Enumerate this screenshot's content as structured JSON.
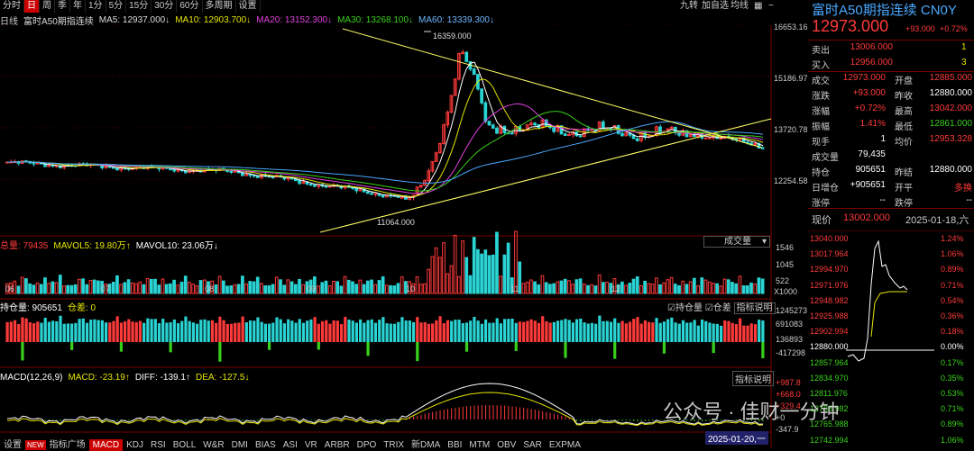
{
  "toolbar": {
    "items": [
      "分时",
      "日",
      "周",
      "季",
      "年",
      "1分",
      "5分",
      "15分",
      "30分",
      "60分",
      "多周期",
      "设置"
    ],
    "active": "日"
  },
  "top_right": {
    "btn1": "九转",
    "btn2": "加自选",
    "btn3": "均线"
  },
  "ma_header": {
    "period": "日线",
    "name": "富时A50期指连续",
    "ma5": "MA5: 12937.000↓",
    "ma10": "MA10: 12903.700↓",
    "ma20": "MA20: 13152.300↓",
    "ma30": "MA30: 13268.100↓",
    "ma60": "MA60: 13339.300↓"
  },
  "price_axis": {
    "t1": "16653.16",
    "t2": "15186.97",
    "t3": "13720.78",
    "t4": "12254.58"
  },
  "annot": {
    "high": "16359.000",
    "low": "11064.000"
  },
  "vol_header": {
    "label": "总量: 79435",
    "mavol5": "MAVOL5: 19.80万↑",
    "mavol10": "MAVOL10: 23.06万↓",
    "select": "成交量"
  },
  "vol_axis": {
    "t1": "1546",
    "t2": "1045",
    "t3": "522",
    "unit": "X1000"
  },
  "oi_header": {
    "label": "持仓量: 905651",
    "diff": "仓差: 0",
    "cb1": "持仓量",
    "cb2": "仓差",
    "explain": "指标说明"
  },
  "oi_axis": {
    "t1": "1245273",
    "t2": "691083",
    "t3": "136893",
    "t4": "-417298"
  },
  "macd_header": {
    "label": "MACD(12,26,9)",
    "macd": "MACD: -23.19↑",
    "diff": "DIFF: -139.1↑",
    "dea": "DEA: -127.5↓",
    "explain": "指标说明"
  },
  "macd_axis": {
    "t1": "+987.8",
    "t2": "+668.0",
    "t3": "+329.4",
    "t4": "+0",
    "t5": "-347.9"
  },
  "months": {
    "m06": "06",
    "m07": "07",
    "m08": "08",
    "m09": "09",
    "m10": "10",
    "m11": "11",
    "m12": "12"
  },
  "date_tag": "2025-01-20,一",
  "bottom_tabs": {
    "items": [
      "设置",
      "指标广场",
      "MACD",
      "KDJ",
      "RSI",
      "BOLL",
      "W&R",
      "DMI",
      "BIAS",
      "ASI",
      "VR",
      "ARBR",
      "DPO",
      "TRIX",
      "新DMA",
      "BBI",
      "MTM",
      "OBV",
      "SAR",
      "EXPMA"
    ],
    "active": "MACD",
    "new_badge": "NEW"
  },
  "quote": {
    "title": "富时A50期指连续 CN0Y",
    "price": "12973.000",
    "change": "+93.000",
    "pct": "+0.72%",
    "sell_label": "卖出",
    "sell_price": "13006.000",
    "sell_vol": "1",
    "buy_label": "买入",
    "buy_price": "12956.000",
    "buy_vol": "3",
    "rows": [
      {
        "k": "成交",
        "v1": "12973.000",
        "k2": "开盘",
        "v2": "12885.000"
      },
      {
        "k": "涨跌",
        "v1": "+93.000",
        "k2": "昨收",
        "v2": "12880.000"
      },
      {
        "k": "涨幅",
        "v1": "+0.72%",
        "k2": "最高",
        "v2": "13042.000"
      },
      {
        "k": "振幅",
        "v1": "1.41%",
        "k2": "最低",
        "v2": "12861.000"
      },
      {
        "k": "现手",
        "v1": "1",
        "k2": "均价",
        "v2": "12953.328"
      },
      {
        "k": "成交量",
        "v1": "79,435",
        "k2": "",
        "v2": ""
      },
      {
        "k": "持仓",
        "v1": "905651",
        "k2": "昨结",
        "v2": "12880.000"
      },
      {
        "k": "日增仓",
        "v1": "+905651",
        "k2": "开平",
        "v2": "多换"
      },
      {
        "k": "涨停",
        "v1": "--",
        "k2": "跌停",
        "v2": "--"
      }
    ],
    "now_label": "现价",
    "now_price": "13002.000",
    "now_date": "2025-01-18,六"
  },
  "intraday": {
    "left": [
      "13040.000",
      "13017.964",
      "12994.970",
      "12971.976",
      "12948.982",
      "12925.988",
      "12902.994",
      "12880.000",
      "12857.964",
      "12834.970",
      "12811.976",
      "12788.982",
      "12765.988",
      "12742.994"
    ],
    "right": [
      "1.24%",
      "1.06%",
      "0.89%",
      "0.71%",
      "0.54%",
      "0.36%",
      "0.18%",
      "0.00%",
      "0.17%",
      "0.35%",
      "0.53%",
      "0.71%",
      "0.89%",
      "1.06%"
    ]
  },
  "watermark": "公众号 · 佳财一分钟"
}
